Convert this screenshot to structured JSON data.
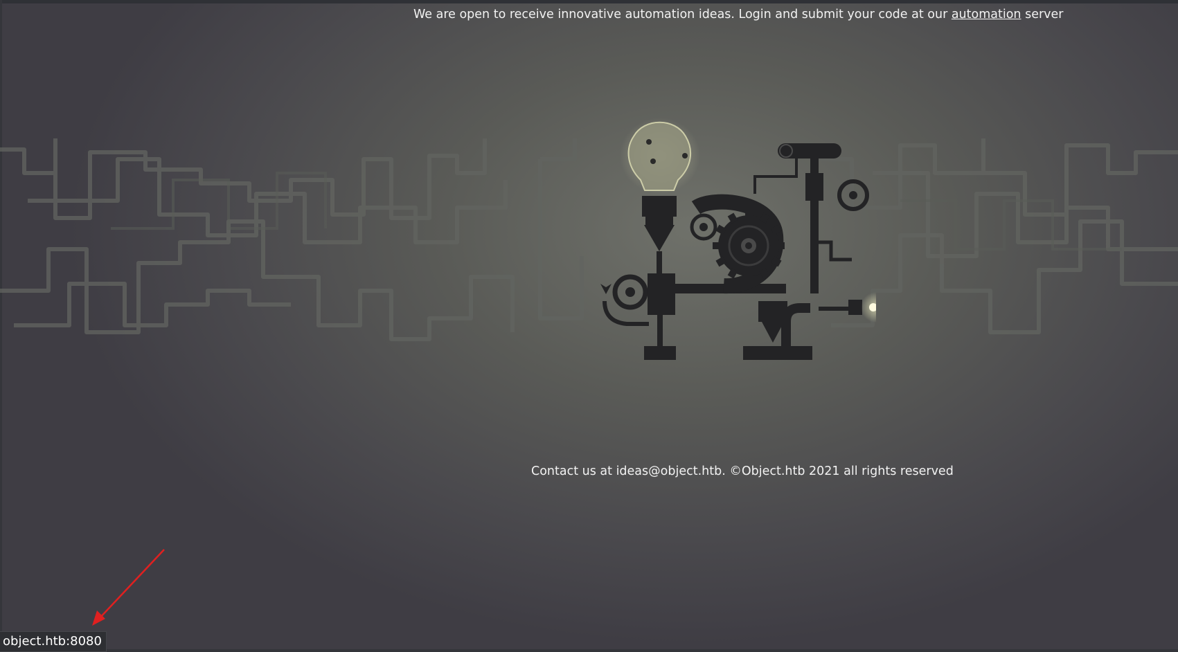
{
  "header": {
    "text_before": "We are open to receive innovative automation ideas. Login and submit your code at our ",
    "link_label": "automation",
    "text_after": " server"
  },
  "footer": {
    "text": "Contact us at ideas@object.htb. ©Object.htb 2021 all rights reserved"
  },
  "status_bar": {
    "url": "object.htb:8080"
  },
  "colors": {
    "arrow": "#e02020",
    "text": "#f2f2f2",
    "machine": "#232325",
    "bulb": "#d8d8b0"
  },
  "illustration": {
    "icon": "steampunk-machine-lightbulb-icon"
  }
}
